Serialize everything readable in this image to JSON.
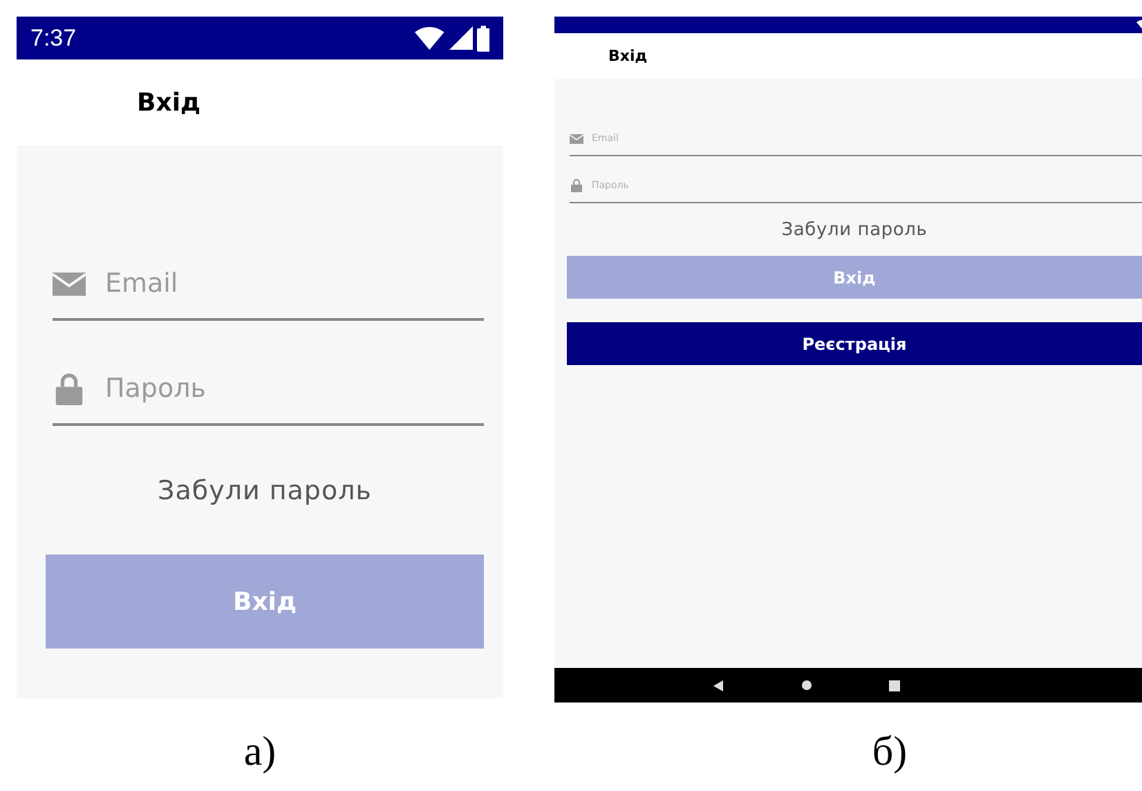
{
  "figure": [
    {
      "caption": "а)",
      "status_bar": {
        "time": "7:37"
      },
      "title": "Вхід",
      "email_field": {
        "placeholder": "Email"
      },
      "password_field": {
        "placeholder": "Пароль"
      },
      "forgot_link": "Забули пароль",
      "buttons": [
        {
          "label": "Вхід",
          "kind": "disabled"
        }
      ]
    },
    {
      "caption": "б)",
      "title": "Вхід",
      "email_field": {
        "placeholder": "Email"
      },
      "password_field": {
        "placeholder": "Пароль"
      },
      "forgot_link": "Забули пароль",
      "buttons": [
        {
          "label": "Вхід",
          "kind": "disabled"
        },
        {
          "label": "Реєстрація",
          "kind": "primary"
        }
      ],
      "nav_bar": true
    }
  ]
}
